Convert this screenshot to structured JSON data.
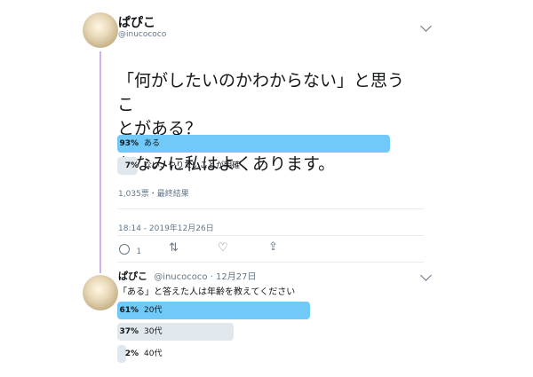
{
  "tweet": {
    "display_name": "ぱぴこ",
    "handle": "@inucococo",
    "text_line1": "「何がしたいのかわからない」と思うこ",
    "text_line2": "とがある？",
    "text_line3": "ちなみに私はよくあります。",
    "poll": [
      {
        "percent": "93%",
        "label": "ある",
        "share": 0.93
      },
      {
        "percent": "7%",
        "label": "ない、やりたいことが明確",
        "share": 0.07
      }
    ],
    "poll_meta": "1,035票・最終結果",
    "timestamp": "18:14 - 2019年12月26日",
    "reply_count": "1"
  },
  "reply": {
    "display_name": "ぱぴこ",
    "handle": "@inucococo",
    "date": "12月27日",
    "text": "「ある」と答えた人は年齢を教えてください",
    "poll": [
      {
        "percent": "61%",
        "label": "20代",
        "share": 0.61
      },
      {
        "percent": "37%",
        "label": "30代",
        "share": 0.37
      },
      {
        "percent": "2%",
        "label": "40代",
        "share": 0.02
      }
    ]
  },
  "icons": [
    "chevron-down-icon",
    "reply-icon",
    "retweet-icon",
    "like-icon",
    "share-icon"
  ],
  "colors": {
    "leading_bar": "#71c9f8",
    "other_bar": "#e1e8ed",
    "thread_line": "#c9b4f0",
    "secondary_text": "#657786"
  }
}
